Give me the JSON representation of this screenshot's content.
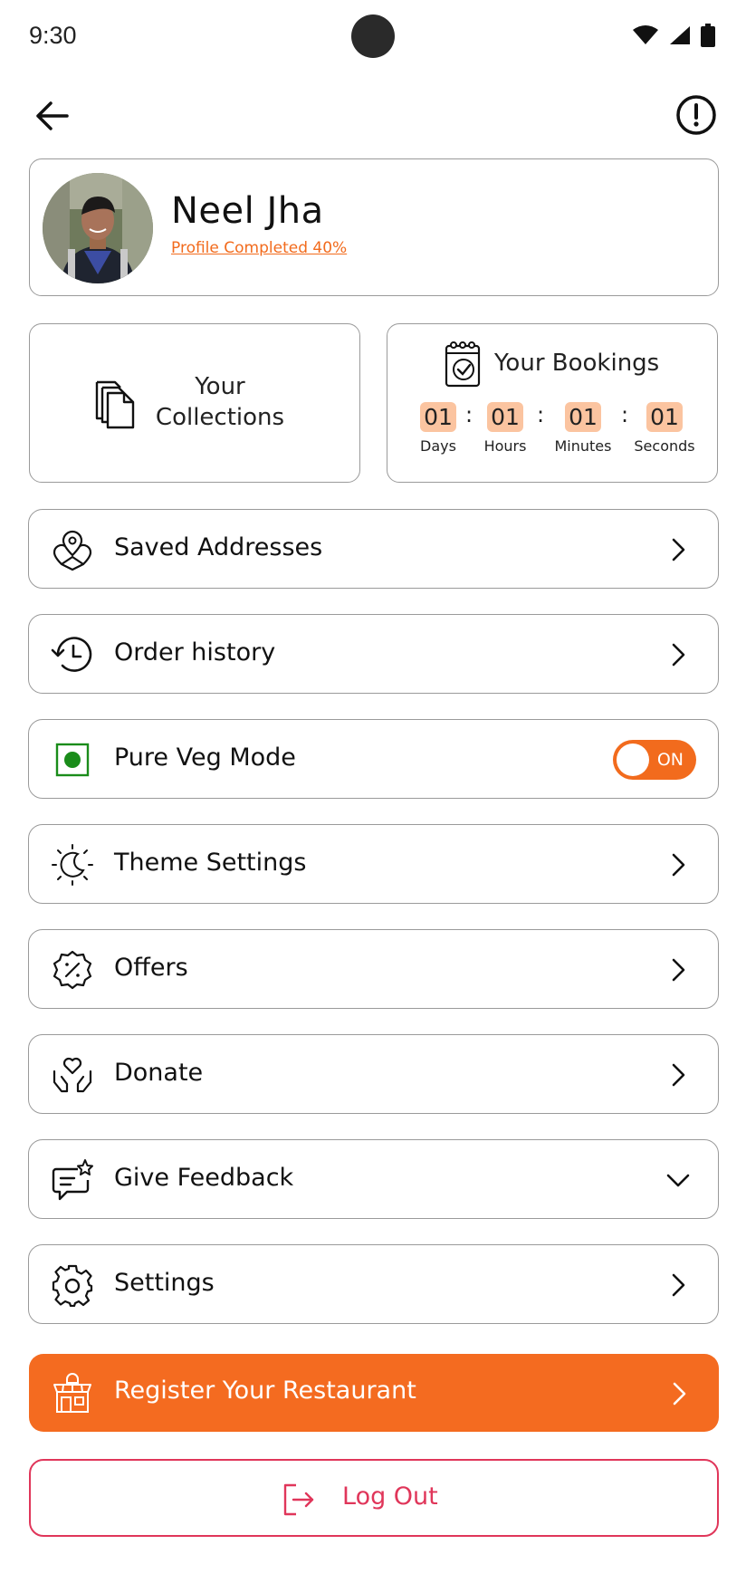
{
  "status_bar": {
    "time": "9:30"
  },
  "profile": {
    "name": "Neel Jha",
    "progress_text": "Profile Completed 40%"
  },
  "collections": {
    "label_line1": "Your",
    "label_line2": "Collections"
  },
  "bookings": {
    "title": "Your Bookings",
    "countdown": [
      {
        "value": "01",
        "label": "Days"
      },
      {
        "value": "01",
        "label": "Hours"
      },
      {
        "value": "01",
        "label": "Minutes"
      },
      {
        "value": "01",
        "label": "Seconds"
      }
    ],
    "separator": ":"
  },
  "menu": {
    "saved_addresses": "Saved Addresses",
    "order_history": "Order history",
    "pure_veg": "Pure Veg Mode",
    "pure_veg_toggle": "ON",
    "theme_settings": "Theme Settings",
    "offers": "Offers",
    "donate": "Donate",
    "give_feedback": "Give Feedback",
    "settings": "Settings",
    "register_restaurant": "Register Your Restaurant"
  },
  "logout": {
    "label": "Log Out"
  },
  "colors": {
    "accent": "#f46b20",
    "countdown_bg": "#fbc4a0",
    "logout": "#e0365a",
    "veg_green": "#1a8c1a"
  },
  "icons": {
    "back": "arrow-left-icon",
    "info": "alert-circle-icon",
    "collections": "copy-files-icon",
    "bookings": "calendar-check-icon",
    "saved_addresses": "map-pins-icon",
    "order_history": "history-clock-icon",
    "pure_veg": "veg-mark-icon",
    "theme": "sun-moon-icon",
    "offers": "discount-badge-icon",
    "donate": "heart-hands-icon",
    "feedback": "chat-star-icon",
    "settings": "gear-icon",
    "restaurant": "store-icon",
    "logout": "logout-icon"
  }
}
